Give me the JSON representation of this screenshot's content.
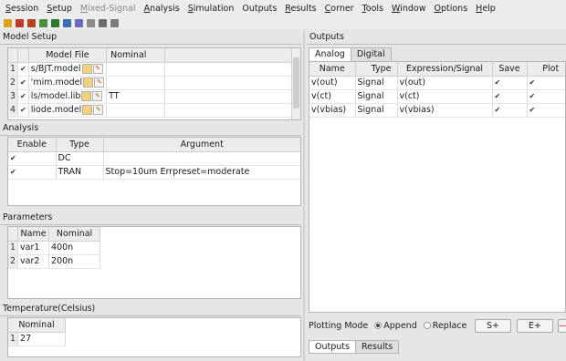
{
  "menubar": {
    "items": [
      {
        "label": "Session",
        "ul": "S",
        "rest": "ession",
        "disabled": false
      },
      {
        "label": "Setup",
        "ul": "S",
        "rest": "etup",
        "disabled": false
      },
      {
        "label": "Mixed-Signal",
        "ul": "M",
        "rest": "ixed-Signal",
        "disabled": true
      },
      {
        "label": "Analysis",
        "ul": "A",
        "rest": "nalysis",
        "disabled": false
      },
      {
        "label": "Simulation",
        "ul": "S",
        "rest": "imulation",
        "disabled": false
      },
      {
        "label": "Outputs",
        "ul": "",
        "rest": "Outputs",
        "disabled": false
      },
      {
        "label": "Results",
        "ul": "R",
        "rest": "esults",
        "disabled": false
      },
      {
        "label": "Corner",
        "ul": "C",
        "rest": "orner",
        "disabled": false
      },
      {
        "label": "Tools",
        "ul": "T",
        "rest": "ools",
        "disabled": false
      },
      {
        "label": "Window",
        "ul": "W",
        "rest": "indow",
        "disabled": false
      },
      {
        "label": "Options",
        "ul": "O",
        "rest": "ptions",
        "disabled": false
      },
      {
        "label": "Help",
        "ul": "H",
        "rest": "elp",
        "disabled": false
      }
    ]
  },
  "toolbar": {
    "icons": [
      {
        "name": "open-session-icon",
        "color": "#d9a21b"
      },
      {
        "name": "save-session-icon",
        "color": "#c0392b"
      },
      {
        "name": "setup-icon",
        "color": "#b8441f"
      },
      {
        "name": "netlist-icon",
        "color": "#4a8f3a"
      },
      {
        "name": "run-icon",
        "color": "#2c7a2c"
      },
      {
        "name": "stop-icon",
        "color": "#3a6fb0"
      },
      {
        "name": "results-icon",
        "color": "#6a6ac0"
      },
      {
        "name": "plot-icon",
        "color": "#8a8a8a"
      },
      {
        "name": "print-icon",
        "color": "#6d6d6d"
      },
      {
        "name": "calculator-icon",
        "color": "#7a7a7a"
      }
    ]
  },
  "model_setup": {
    "title": "Model Setup",
    "headers": [
      "Model File",
      "Nominal"
    ],
    "rows": [
      {
        "num": "1",
        "file": "s/BJT.model",
        "nominal": ""
      },
      {
        "num": "2",
        "file": "'mim.model",
        "nominal": ""
      },
      {
        "num": "3",
        "file": "ls/model.lib",
        "nominal": "TT"
      },
      {
        "num": "4",
        "file": "liode.model",
        "nominal": ""
      }
    ]
  },
  "analysis": {
    "title": "Analysis",
    "headers": [
      "Enable",
      "Type",
      "Argument"
    ],
    "rows": [
      {
        "enabled": true,
        "type": "DC",
        "argument": ""
      },
      {
        "enabled": true,
        "type": "TRAN",
        "argument": "Stop=10um Errpreset=moderate"
      }
    ]
  },
  "parameters": {
    "title": "Parameters",
    "headers": [
      "Name",
      "Nominal"
    ],
    "rows": [
      {
        "num": "1",
        "name": "var1",
        "nominal": "400n"
      },
      {
        "num": "2",
        "name": "var2",
        "nominal": "200n"
      }
    ]
  },
  "temperature": {
    "title": "Temperature(Celsius)",
    "header": "Nominal",
    "rows": [
      {
        "num": "1",
        "value": "27"
      }
    ]
  },
  "outputs": {
    "title": "Outputs",
    "tabs": [
      "Analog",
      "Digital"
    ],
    "headers": [
      "Name",
      "Type",
      "Expression/Signal",
      "Save",
      "Plot"
    ],
    "rows": [
      {
        "name": "v(out)",
        "type": "Signal",
        "expr": "v(out)",
        "save": true,
        "plot": true
      },
      {
        "name": "v(ct)",
        "type": "Signal",
        "expr": "v(ct)",
        "save": true,
        "plot": true
      },
      {
        "name": "v(vbias)",
        "type": "Signal",
        "expr": "v(vbias)",
        "save": true,
        "plot": true
      }
    ],
    "plotting_mode_label": "Plotting Mode",
    "plotting_options": [
      "Append",
      "Replace"
    ],
    "selected_plotting_option": "Append",
    "buttons": [
      "S+",
      "E+",
      "—"
    ],
    "bottom_tabs": [
      "Outputs",
      "Results"
    ]
  }
}
